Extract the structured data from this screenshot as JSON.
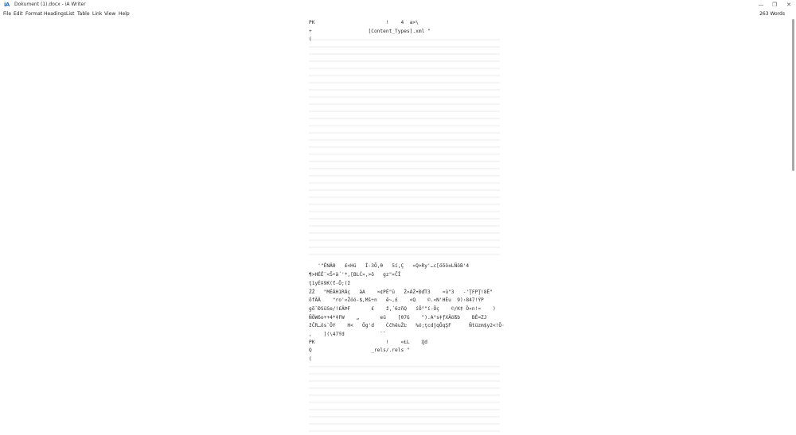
{
  "window": {
    "logo": "iA",
    "title": "Dokument (1).docx - iA Writer",
    "minimize_glyph": "—",
    "maximize_glyph": "❐",
    "close_glyph": "✕"
  },
  "menu": {
    "items": [
      "File",
      "Edit",
      "Format",
      "Headings",
      "List",
      "Table",
      "Link",
      "View",
      "Help"
    ]
  },
  "status": {
    "word_count": "263 Words"
  },
  "document": {
    "lines": [
      "PK                        !    4  a>\\",
      "+                   [Content_Types].xml \"",
      "(",
      "   '\"ÊNÄΘ   £<Hü   Í-3Õ,θ   5í,Ç   «Q>Ry'…c[öõö±LÑöB'4",
      "¶>HÉÊ¨<Š•ä´'*,[BLĆ»,>ŏ   gz\"«ĈĬ",
      "ţ1yÉ‡9K(ť-Ō;(ž",
      "ŽŽ   \"MÉÄH1RÄç   äA    ¤¢PÊ\"ü   Ž»ÀŽ•ÐďT3    ¤ü\"3   -'ŢFPŢ!8Ë\"",
      "õfÃÄ    \"ro'«Žóó-$,Mš÷n   ê~,£    <Q    ©.«N'HÉu  9)›847!ÝP",
      "gõ`ÐSüSe/!£ÂÞF       £    ž,´6zñQ   íÕ°\"í-Õç    ©/K‡ Ö«n!¤    )",
      "ÑÖW6o++4*‡FW    „       eü    [θ7G    \").A°s‡ƒXÄößb    BÊ=ZJ",
      "žČR…ös`ÕY    H<   Ög'd    ĊĉhěuŽĿ   %ó;ţcdĵqÕqŞF      Ñtüzm$y2<!Õ·",
      ",    ](\\47Ýd            ``",
      "PK                        !    «ŁL    ĳd",
      "Q                    _rels/.rels \"",
      "("
    ]
  }
}
